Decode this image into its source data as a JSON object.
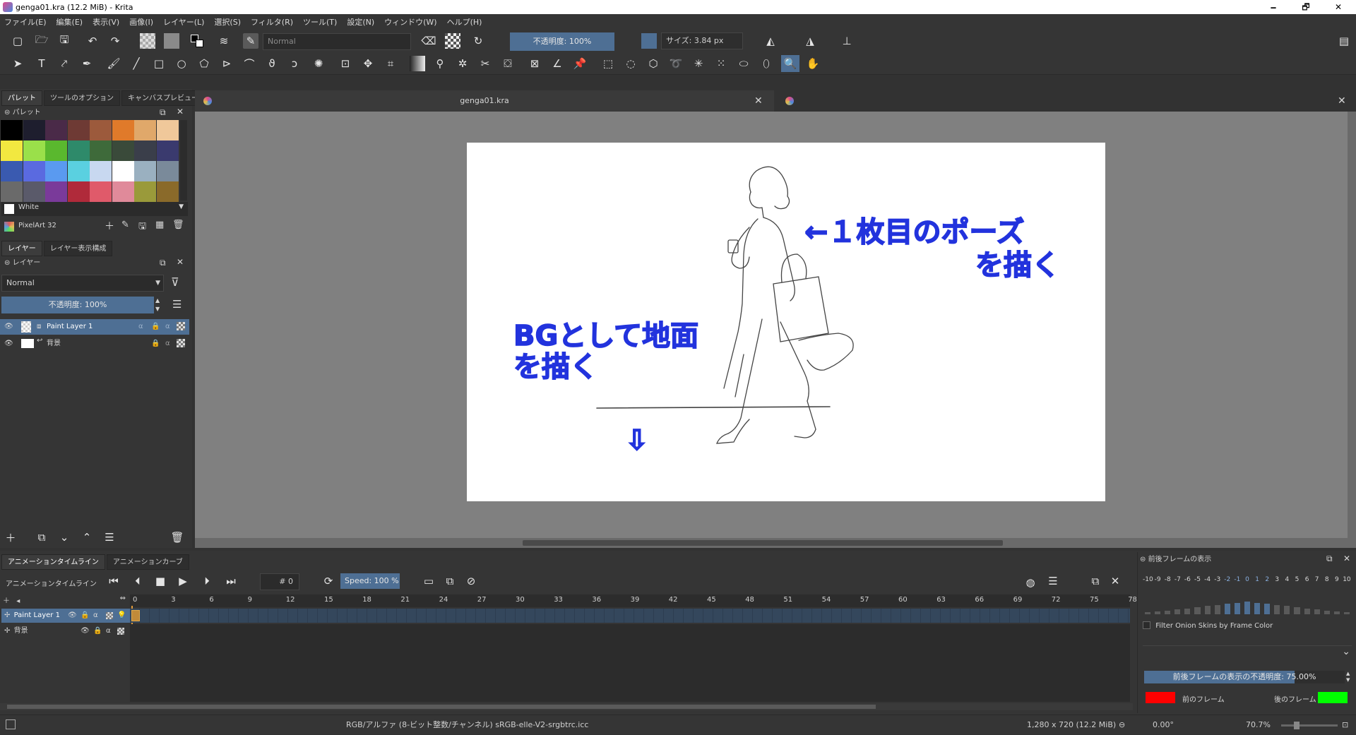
{
  "window": {
    "title": "genga01.kra (12.2 MiB)  - Krita",
    "minimize": "🗕",
    "maximize": "🗗",
    "close": "✕"
  },
  "menu": [
    "ファイル(E)",
    "編集(E)",
    "表示(V)",
    "画像(I)",
    "レイヤー(L)",
    "選択(S)",
    "フィルタ(R)",
    "ツール(T)",
    "設定(N)",
    "ウィンドウ(W)",
    "ヘルプ(H)"
  ],
  "toolbar": {
    "blend_mode": "Normal",
    "opacity": "不透明度: 100%",
    "size": "サイズ: 3.84 px"
  },
  "left_tabs": [
    "パレット",
    "ツールのオプション",
    "キャンバスプレビュー"
  ],
  "palette": {
    "title": "パレット",
    "colors": [
      "#000000",
      "#1e1e2e",
      "#4a2a48",
      "#6e3a34",
      "#9c5a3c",
      "#e07a2a",
      "#e0a86a",
      "#f0c89a",
      "#f2e840",
      "#9ae04a",
      "#5ab82e",
      "#2e8a6a",
      "#3e6a3a",
      "#3a4a3a",
      "#3a3e4a",
      "#3a3a6e",
      "#3a5ab0",
      "#5a6ae0",
      "#5a9af0",
      "#5ad0e0",
      "#c8d8f0",
      "#ffffff",
      "#9ab0c0",
      "#7a8a9a",
      "#6a6a6a",
      "#5a5a6a",
      "#7a3a9a",
      "#b02a3a",
      "#e05a6a",
      "#e08a9a",
      "#9a9a3a",
      "#8a6a2a"
    ],
    "current_color_name": "White",
    "palette_name": "PixelArt 32"
  },
  "layers_tabs": [
    "レイヤー",
    "レイヤー表示構成"
  ],
  "layers": {
    "title": "レイヤー",
    "blend_mode": "Normal",
    "opacity": "不透明度: 100%",
    "items": [
      {
        "name": "Paint Layer 1",
        "selected": true
      },
      {
        "name": "背景",
        "selected": false
      }
    ]
  },
  "doc_tabs": [
    {
      "name": "genga01.kra"
    },
    {
      "name": ""
    }
  ],
  "annotations": {
    "pose_arrow": "←１枚目のポーズ",
    "pose_line2": "を描く",
    "bg_line1": "BGとして地面",
    "bg_line2": "を描く",
    "down_arrow": "⇩"
  },
  "timeline": {
    "tabs": [
      "アニメーションタイムライン",
      "アニメーションカーブ"
    ],
    "title": "アニメーションタイムライン",
    "frame_number": "# 0",
    "speed": "Speed: 100 %",
    "ruler": [
      "0",
      "3",
      "6",
      "9",
      "12",
      "15",
      "18",
      "21",
      "24",
      "27",
      "30",
      "33",
      "36",
      "39",
      "42",
      "45",
      "48",
      "51",
      "54",
      "57",
      "60",
      "63",
      "66",
      "69",
      "72",
      "75",
      "78"
    ],
    "layers": [
      "Paint Layer 1",
      "背景"
    ]
  },
  "onion": {
    "title": "前後フレームの表示",
    "frames": [
      "-10",
      "-9",
      "-8",
      "-7",
      "-6",
      "-5",
      "-4",
      "-3",
      "-2",
      "-1",
      "0",
      "1",
      "2",
      "3",
      "4",
      "5",
      "6",
      "7",
      "8",
      "9",
      "10"
    ],
    "filter_label": "Filter Onion Skins by Frame Color",
    "opacity": "前後フレームの表示の不透明度: 75.00%",
    "prev_label": "前のフレーム",
    "next_label": "後のフレーム",
    "prev_color": "#ff0000",
    "next_color": "#00ff00"
  },
  "status": {
    "color_info": "RGB/アルファ (8-ビット整数/チャンネル)  sRGB-elle-V2-srgbtrc.icc",
    "dims": "1,280 x 720 (12.2 MiB)",
    "rotation": "0.00°",
    "zoom": "70.7%"
  }
}
